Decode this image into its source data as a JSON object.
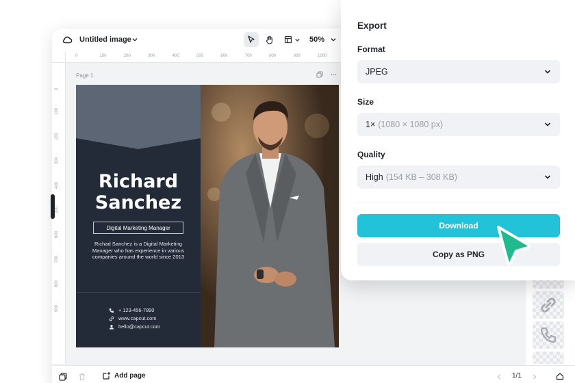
{
  "editor": {
    "doc_title": "Untitled image",
    "zoom": "50%",
    "page_label": "Page 1",
    "ruler_h": [
      "0",
      "100",
      "200",
      "300",
      "400",
      "500",
      "600",
      "700",
      "800",
      "900",
      "1000"
    ],
    "ruler_v": [
      "0",
      "100",
      "200",
      "300",
      "400",
      "500",
      "600",
      "700",
      "800",
      "900"
    ],
    "add_page_label": "Add page",
    "pager": "1/1"
  },
  "design": {
    "name_line1": "Richard",
    "name_line2": "Sanchez",
    "role": "Digital Marketing Manager",
    "bio": "Richad Sanchez is a Digital Marketing Manager who has experience in various companies around the world since 2013",
    "phone": "+ 123-456-7890",
    "website": "www.capcut.com",
    "email": "hello@capcut.com",
    "colors": {
      "panel": "#232b38",
      "header": "#5d6674"
    }
  },
  "export_panel": {
    "title": "Export",
    "format_label": "Format",
    "format_value": "JPEG",
    "size_label": "Size",
    "size_value": "1×",
    "size_detail": "(1080 × 1080 px)",
    "quality_label": "Quality",
    "quality_value": "High",
    "quality_detail": "(154 KB – 308 KB)",
    "download_label": "Download",
    "copy_label": "Copy as PNG",
    "accent": "#22c3d8",
    "cursor_color": "#1fba8e"
  }
}
